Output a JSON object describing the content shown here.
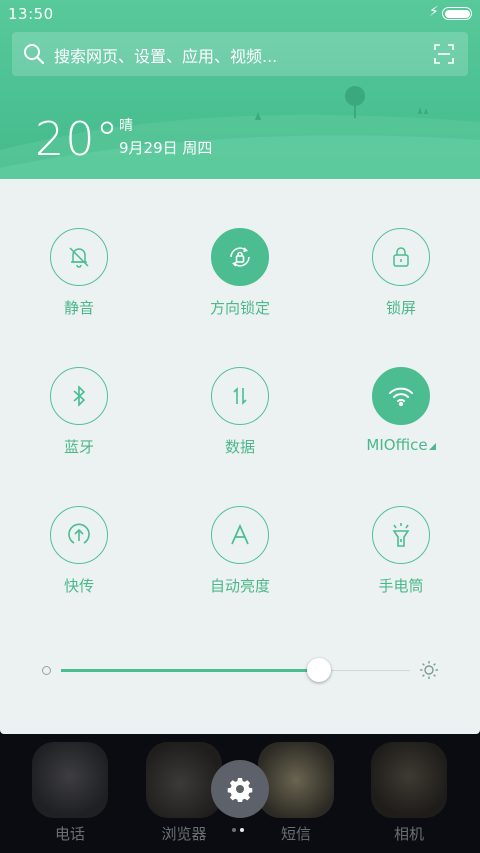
{
  "status": {
    "time": "13:50"
  },
  "search": {
    "placeholder": "搜索网页、设置、应用、视频..."
  },
  "weather": {
    "temperature": "20°",
    "condition": "晴",
    "date": "9月29日 周四"
  },
  "toggles": [
    {
      "label": "静音",
      "icon": "bell-muted-icon",
      "active": false
    },
    {
      "label": "方向锁定",
      "icon": "rotation-lock-icon",
      "active": true
    },
    {
      "label": "锁屏",
      "icon": "lock-icon",
      "active": false
    },
    {
      "label": "蓝牙",
      "icon": "bluetooth-icon",
      "active": false
    },
    {
      "label": "数据",
      "icon": "mobile-data-icon",
      "active": false
    },
    {
      "label": "MIOffice",
      "icon": "wifi-icon",
      "active": true
    },
    {
      "label": "快传",
      "icon": "quick-transfer-icon",
      "active": false
    },
    {
      "label": "自动亮度",
      "icon": "auto-brightness-icon",
      "active": false
    },
    {
      "label": "手电筒",
      "icon": "flashlight-icon",
      "active": false
    }
  ],
  "brightness": {
    "level": 0.74
  },
  "dock": {
    "apps": [
      {
        "label": "电话"
      },
      {
        "label": "浏览器"
      },
      {
        "label": "短信"
      },
      {
        "label": "相机"
      }
    ],
    "page_count": 2,
    "current_page": 2
  },
  "colors": {
    "accent": "#4bbd90",
    "header": "#4cc193",
    "panel": "#ecf2f2"
  }
}
